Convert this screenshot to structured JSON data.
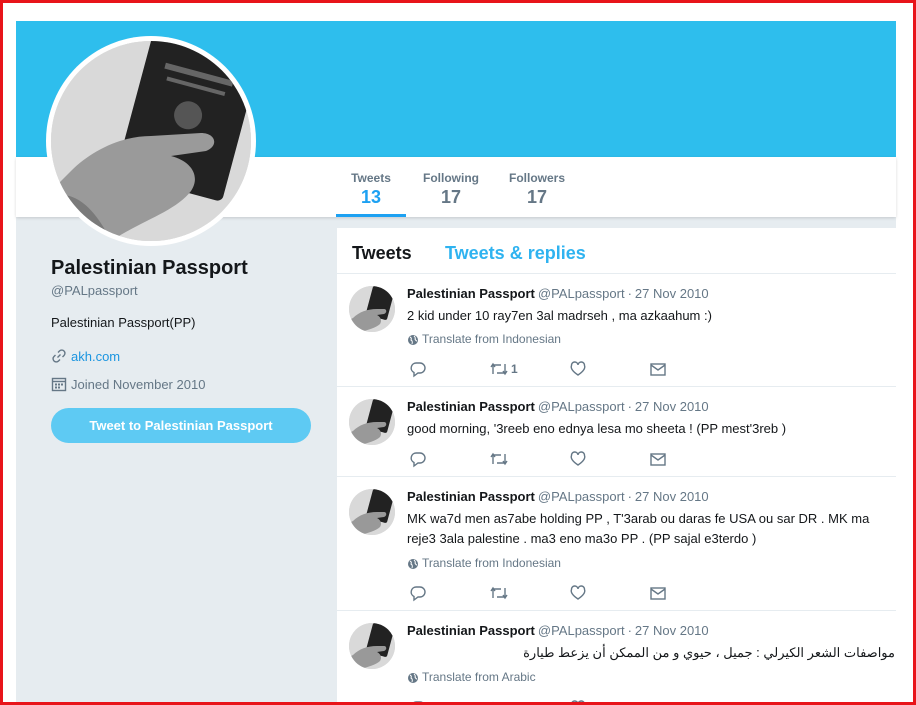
{
  "profile": {
    "name": "Palestinian Passport",
    "handle": "@PALpassport",
    "bio": "Palestinian Passport(PP)",
    "link": "akh.com",
    "joined": "Joined November 2010",
    "tweet_to_label": "Tweet to Palestinian Passport"
  },
  "nav": [
    {
      "label": "Tweets",
      "value": "13",
      "active": true
    },
    {
      "label": "Following",
      "value": "17"
    },
    {
      "label": "Followers",
      "value": "17"
    }
  ],
  "tabs": {
    "tweets": "Tweets",
    "replies": "Tweets & replies"
  },
  "tweets": [
    {
      "name": "Palestinian Passport",
      "handle": "@PALpassport",
      "date": "27 Nov 2010",
      "text": "2 kid under 10 ray7en 3al madrseh , ma azkaahum :)",
      "translate": "Translate from Indonesian",
      "retweets": "1"
    },
    {
      "name": "Palestinian Passport",
      "handle": "@PALpassport",
      "date": "27 Nov 2010",
      "text": "good morning, '3reeb eno ednya lesa mo sheeta !  (PP mest'3reb )",
      "translate": "",
      "retweets": ""
    },
    {
      "name": "Palestinian Passport",
      "handle": "@PALpassport",
      "date": "27 Nov 2010",
      "text": "MK wa7d men as7abe holding PP , T'3arab ou daras fe USA ou sar DR . MK ma reje3 3ala palestine . ma3 eno ma3o PP . (PP sajal e3terdo )",
      "translate": "Translate from Indonesian",
      "retweets": ""
    },
    {
      "name": "Palestinian Passport",
      "handle": "@PALpassport",
      "date": "27 Nov 2010",
      "text": "مواصفات الشعر الكيرلي : جميل ، حيوي و من الممكن أن يزعط طيارة",
      "translate": "Translate from Arabic",
      "retweets": ""
    }
  ],
  "colors": {
    "banner": "#2ebeed",
    "accent": "#1da1f2",
    "frame": "#e8141a",
    "button": "#5ecaf3"
  },
  "icons": {
    "link": "link-icon",
    "calendar": "calendar-icon",
    "globe": "globe-icon",
    "reply": "reply-icon",
    "retweet": "retweet-icon",
    "like": "heart-icon",
    "message": "message-icon"
  }
}
